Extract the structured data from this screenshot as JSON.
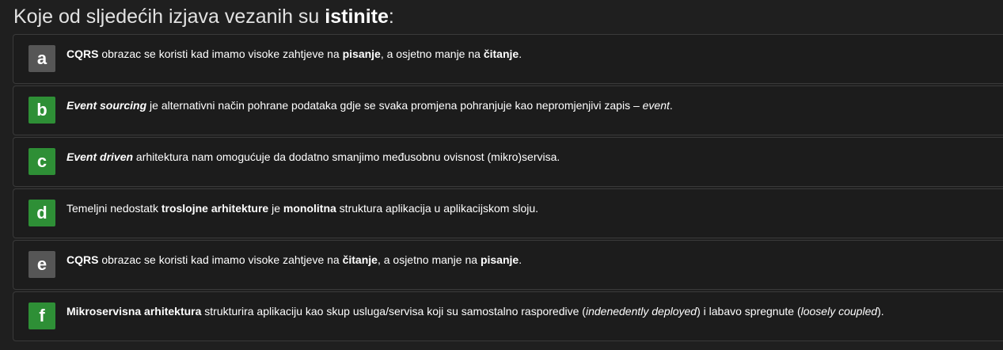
{
  "question": {
    "prefix": "Koje od sljedećih izjava vezanih su ",
    "emphasis": "istinite",
    "suffix": ":"
  },
  "options": [
    {
      "letter": "a",
      "status": "not-selected",
      "color": "#565656",
      "segments": [
        {
          "text": "CQRS",
          "style": "bold"
        },
        {
          "text": " obrazac se koristi kad imamo visoke zahtjeve na ",
          "style": "normal"
        },
        {
          "text": "pisanje",
          "style": "bold"
        },
        {
          "text": ", a osjetno manje na ",
          "style": "normal"
        },
        {
          "text": "čitanje",
          "style": "bold"
        },
        {
          "text": ".",
          "style": "normal"
        }
      ]
    },
    {
      "letter": "b",
      "status": "correct",
      "color": "#2e8f36",
      "segments": [
        {
          "text": "Event sourcing",
          "style": "bold-italic"
        },
        {
          "text": " je alternativni način pohrane podataka gdje se svaka promjena pohranjuje kao nepromjenjivi zapis – ",
          "style": "normal"
        },
        {
          "text": "event",
          "style": "italic"
        },
        {
          "text": ".",
          "style": "normal"
        }
      ]
    },
    {
      "letter": "c",
      "status": "correct",
      "color": "#2e8f36",
      "segments": [
        {
          "text": "Event driven",
          "style": "bold-italic"
        },
        {
          "text": " arhitektura nam omogućuje da dodatno smanjimo međusobnu ovisnost (mikro)servisa.",
          "style": "normal"
        }
      ]
    },
    {
      "letter": "d",
      "status": "correct",
      "color": "#2e8f36",
      "segments": [
        {
          "text": "Temeljni nedostatk ",
          "style": "normal"
        },
        {
          "text": "troslojne arhitekture",
          "style": "bold"
        },
        {
          "text": " je ",
          "style": "normal"
        },
        {
          "text": "monolitna",
          "style": "bold"
        },
        {
          "text": " struktura aplikacija u aplikacijskom sloju.",
          "style": "normal"
        }
      ]
    },
    {
      "letter": "e",
      "status": "not-selected",
      "color": "#565656",
      "segments": [
        {
          "text": "CQRS",
          "style": "bold"
        },
        {
          "text": " obrazac se koristi kad imamo visoke zahtjeve na ",
          "style": "normal"
        },
        {
          "text": "čitanje",
          "style": "bold"
        },
        {
          "text": ", a osjetno manje na ",
          "style": "normal"
        },
        {
          "text": "pisanje",
          "style": "bold"
        },
        {
          "text": ".",
          "style": "normal"
        }
      ]
    },
    {
      "letter": "f",
      "status": "correct",
      "color": "#2e8f36",
      "segments": [
        {
          "text": "Mikroservisna arhitektura",
          "style": "bold"
        },
        {
          "text": " strukturira aplikaciju kao skup usluga/servisa koji su samostalno rasporedive (",
          "style": "normal"
        },
        {
          "text": "indenedently deployed",
          "style": "italic"
        },
        {
          "text": ") i labavo spregnute (",
          "style": "normal"
        },
        {
          "text": "loosely coupled",
          "style": "italic"
        },
        {
          "text": ").",
          "style": "normal"
        }
      ]
    }
  ]
}
